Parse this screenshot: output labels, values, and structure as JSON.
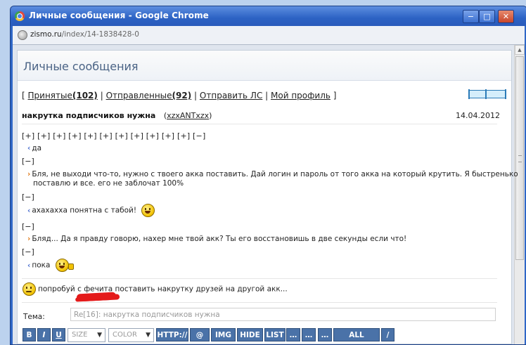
{
  "window": {
    "title": "Личные сообщения - Google Chrome",
    "controls": {
      "minimize": "−",
      "maximize": "□",
      "close": "✕"
    }
  },
  "address": {
    "host": "zismo.ru",
    "path": "/index/14-1838428-0"
  },
  "page": {
    "title": "Личные сообщения",
    "nav": {
      "open": "[",
      "received_label": "Принятые",
      "received_count": "(102)",
      "sep1": "|",
      "sent_label": "Отправленные",
      "sent_count": "(92)",
      "sep2": "|",
      "send_pm": "Отправить ЛС",
      "sep3": "|",
      "my_profile": "Мой профиль",
      "close": "]"
    }
  },
  "message": {
    "subject": "накрутка подписчиков нужна",
    "author": "xzxANTxzx",
    "date": "14.04.2012",
    "expanders": "[+] [+] [+] [+] [+] [+] [+] [+] [+] [+] [+] [−]",
    "collapse": "[−]",
    "thread": [
      {
        "dir": "in",
        "text": "да"
      },
      {
        "dir": "out",
        "text": "Бля, не выходи что-то, нужно с твоего акка поставить. Дай логин и пароль от того акка на который крутить. Я быстренько",
        "text2": "поставлю и все. его не заблочат 100%"
      },
      {
        "dir": "in",
        "text": "ахахахха понятна с табой!"
      },
      {
        "dir": "out",
        "text": "Бляд... Да я правду говорю, нахер мне твой акк? Ты его восстановишь в две секунды если что!"
      },
      {
        "dir": "in",
        "text": "пока"
      }
    ],
    "last": "попробуй с фечита поставить накрутку друзей на другой акк..."
  },
  "reply": {
    "tema_label": "Тема:",
    "tema_value": "Re[16]: накрутка подписчиков нужна",
    "toolbar": {
      "b": "B",
      "i": "I",
      "u": "U",
      "size": "SIZE",
      "color": "COLOR",
      "http": "HTTP://",
      "at": "@",
      "img": "IMG",
      "hide": "HIDE",
      "list": "LIST",
      "more1": "…",
      "more2": "…",
      "more3": "…",
      "all_codes": "ALL CODES",
      "slash": "/"
    }
  }
}
